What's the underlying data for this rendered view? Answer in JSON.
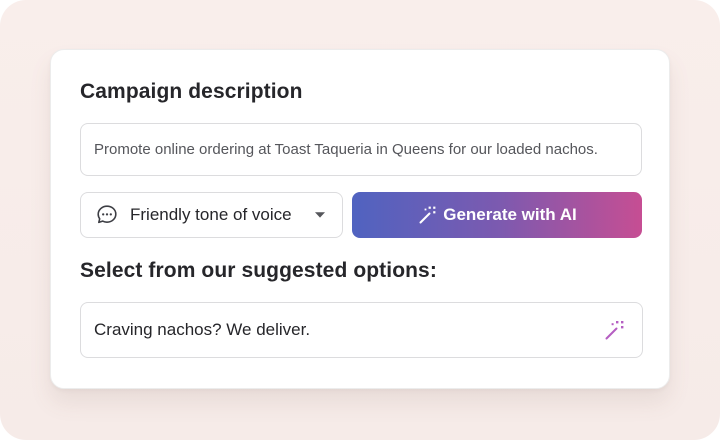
{
  "campaign": {
    "title": "Campaign description",
    "description_value": "Promote online ordering at Toast Taqueria in Queens for our loaded nachos."
  },
  "tone": {
    "icon": "chat-bubble-icon",
    "selected": "Friendly tone of voice",
    "dropdown_icon": "caret-down-icon"
  },
  "generate": {
    "icon": "magic-wand-icon",
    "label": "Generate with AI"
  },
  "suggestions": {
    "title": "Select from our suggested options:",
    "options": [
      {
        "text": "Craving nachos? We deliver.",
        "icon": "magic-wand-icon"
      }
    ]
  },
  "colors": {
    "background": "#f9eeeb",
    "card": "#ffffff",
    "button_gradient_start": "#5063c0",
    "button_gradient_end": "#c64e93",
    "text": "#26262a",
    "border": "#dcdcde"
  }
}
